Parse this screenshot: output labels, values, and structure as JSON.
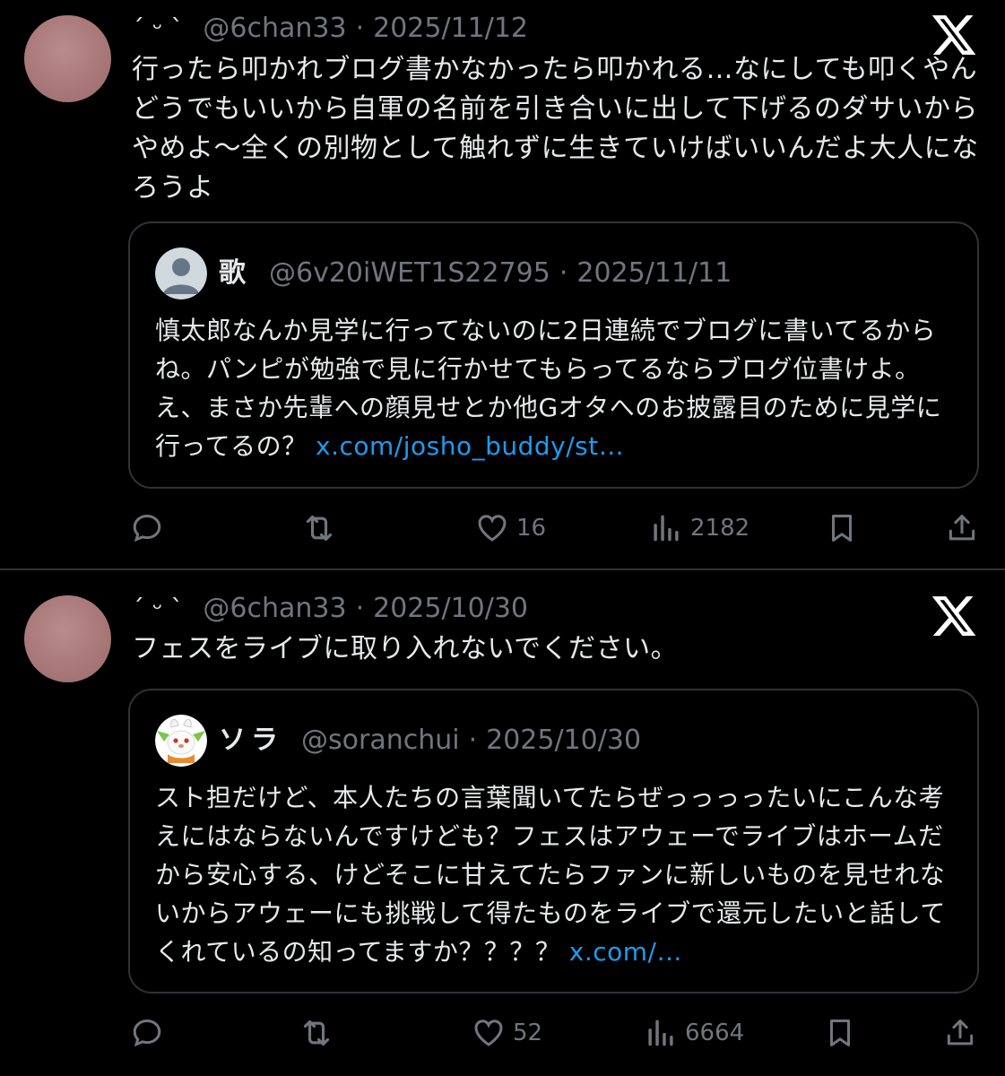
{
  "posts": [
    {
      "author": {
        "display_name": "´ ᵕ ` ",
        "handle": "@6chan33",
        "date": "2025/11/12",
        "avatar_color": "#a97878"
      },
      "separator": "·",
      "text": "行ったら叩かれブログ書かなかったら叩かれる…なにしても叩くやんどうでもいいから自軍の名前を引き合いに出して下げるのダサいからやめよ〜全くの別物として触れずに生きていけばいいんだよ大人になろうよ",
      "quote": {
        "display_name": "歌",
        "handle": "@6v20iWET1S22795",
        "date": "2025/11/11",
        "avatar": "default-avatar-icon",
        "text": "慎太郎なんか見学に行ってないのに2日連続でブログに書いてるからね。パンピが勉強で見に行かせてもらってるならブログ位書けよ。え、まさか先輩への顔見せとか他Gオタへのお披露目のために見学に行ってるの？ ",
        "link": "x.com/josho_buddy/st…"
      },
      "actions": {
        "reply_icon": "reply-icon",
        "repost_icon": "repost-icon",
        "like_icon": "heart-icon",
        "likes": "16",
        "views_icon": "views-icon",
        "views": "2182",
        "bookmark_icon": "bookmark-icon",
        "share_icon": "share-icon"
      }
    },
    {
      "author": {
        "display_name": "´ ᵕ ` ",
        "handle": "@6chan33",
        "date": "2025/10/30",
        "avatar_color": "#a97878"
      },
      "separator": "·",
      "text": "フェスをライブに取り入れないでください。",
      "quote": {
        "display_name": "ソラ",
        "handle": "@soranchui",
        "date": "2025/10/30",
        "avatar": "rabbit-character-icon",
        "text": "スト担だけど、本人たちの言葉聞いてたらぜっっっったいにこんな考えにはならないんですけども？フェスはアウェーでライブはホームだから安心する、けどそこに甘えてたらファンに新しいものを見せれないからアウェーにも挑戦して得たものをライブで還元したいと話してくれているの知ってますか？？？？ ",
        "link": "x.com/…"
      },
      "actions": {
        "reply_icon": "reply-icon",
        "repost_icon": "repost-icon",
        "like_icon": "heart-icon",
        "likes": "52",
        "views_icon": "views-icon",
        "views": "6664",
        "bookmark_icon": "bookmark-icon",
        "share_icon": "share-icon"
      }
    }
  ],
  "colors": {
    "background": "#000000",
    "text": "#e7e9ea",
    "muted": "#71767b",
    "link": "#1d9bf0",
    "border": "#2f3336"
  },
  "x_logo_icon": "x-logo-icon"
}
